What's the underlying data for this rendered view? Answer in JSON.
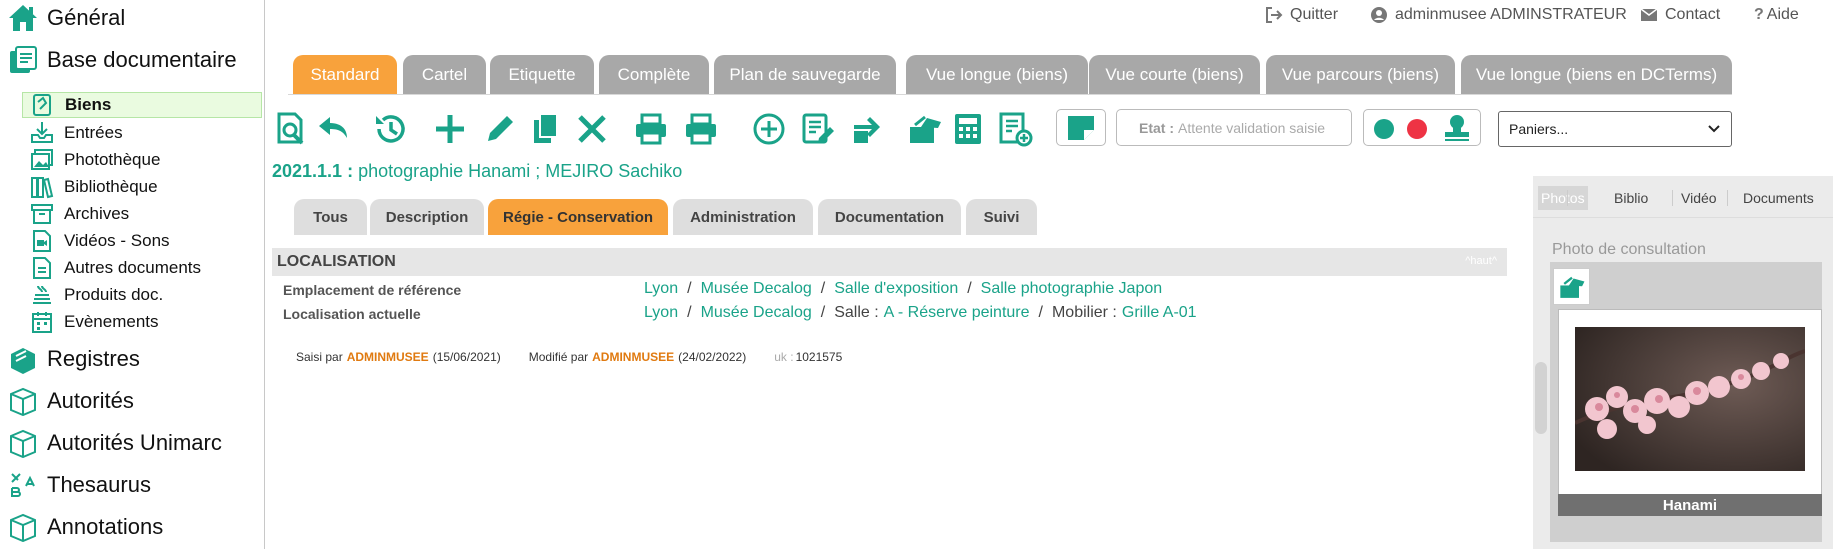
{
  "colors": {
    "accent": "#1aa389",
    "tab_active": "#f8a23c",
    "tab_inactive": "#a8a8a8",
    "user": "#e07a10"
  },
  "sidebar": {
    "general": {
      "label": "Général",
      "icon": "home-icon"
    },
    "base_doc": {
      "label": "Base documentaire",
      "icon": "documents-icon"
    },
    "sub_items": [
      {
        "label": "Biens",
        "icon": "objects-icon",
        "active": true
      },
      {
        "label": "Entrées",
        "icon": "inbox-icon"
      },
      {
        "label": "Photothèque",
        "icon": "photos-icon"
      },
      {
        "label": "Bibliothèque",
        "icon": "books-icon"
      },
      {
        "label": "Archives",
        "icon": "archive-box-icon"
      },
      {
        "label": "Vidéos - Sons",
        "icon": "video-file-icon"
      },
      {
        "label": "Autres documents",
        "icon": "file-icon"
      },
      {
        "label": "Produits doc.",
        "icon": "doc-products-icon"
      },
      {
        "label": "Evènements",
        "icon": "calendar-icon"
      }
    ],
    "main_items": [
      {
        "label": "Registres",
        "icon": "registers-icon"
      },
      {
        "label": "Autorités",
        "icon": "cube-icon"
      },
      {
        "label": "Autorités Unimarc",
        "icon": "cube-icon"
      },
      {
        "label": "Thesaurus",
        "icon": "thesaurus-icon"
      },
      {
        "label": "Annotations",
        "icon": "cube-icon"
      }
    ]
  },
  "top_links": {
    "quit": "Quitter",
    "user": "adminmusee ADMINSTRATEUR",
    "contact": "Contact",
    "help": "Aide"
  },
  "view_tabs": [
    "Standard",
    "Cartel",
    "Etiquette",
    "Complète",
    "Plan de sauvegarde",
    "Vue longue (biens)",
    "Vue courte (biens)",
    "Vue parcours (biens)",
    "Vue longue (biens en DCTerms)"
  ],
  "toolbar": {
    "etat_label": "Etat :",
    "etat_value": "Attente validation saisie",
    "paniers": "Paniers..."
  },
  "record": {
    "number": "2021.1.1 :",
    "title": "photographie Hanami ; MEJIRO Sachiko"
  },
  "sub_tabs": [
    "Tous",
    "Description",
    "Régie - Conservation",
    "Administration",
    "Documentation",
    "Suivi"
  ],
  "section": {
    "title": "LOCALISATION",
    "haut": "^haut^",
    "ref_label": "Emplacement de référence",
    "ref_path": [
      "Lyon",
      "Musée Decalog",
      "Salle d'exposition",
      "Salle photographie Japon"
    ],
    "cur_label": "Localisation actuelle",
    "cur_path": {
      "lyon": "Lyon",
      "musee": "Musée Decalog",
      "salle_label": "Salle :",
      "salle": "A - Réserve peinture",
      "mobilier_label": "Mobilier :",
      "mobilier": "Grille A-01"
    }
  },
  "meta": {
    "saisi_par": "Saisi par",
    "saisi_user": "ADMINMUSEE",
    "saisi_date": "(15/06/2021)",
    "modifie_par": "Modifié par",
    "modifie_user": "ADMINMUSEE",
    "modifie_date": "(24/02/2022)",
    "uk_label": "uk :",
    "uk_value": "1021575"
  },
  "right_panel": {
    "tabs": [
      "Photos",
      "Biblio",
      "Vidéo",
      "Documents"
    ],
    "photo_title": "Photo de consultation",
    "caption": "Hanami"
  }
}
